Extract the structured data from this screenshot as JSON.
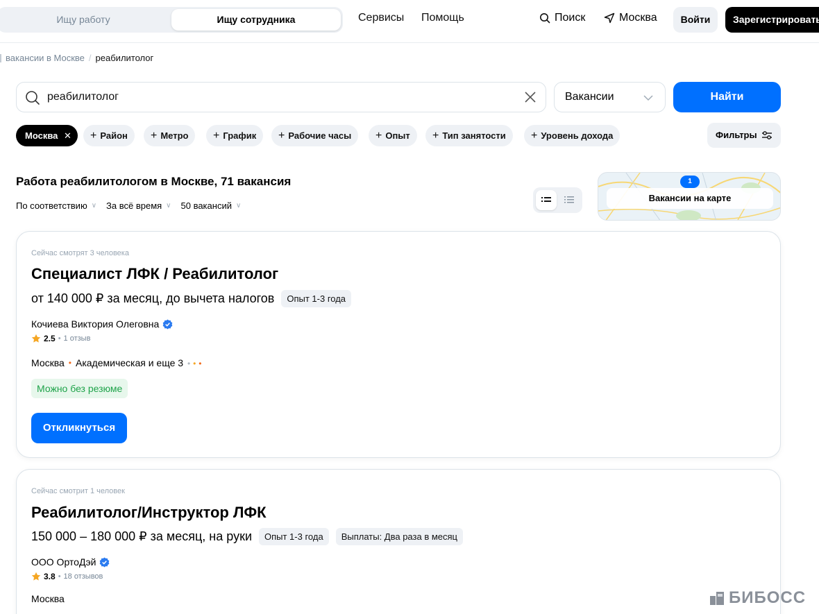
{
  "header": {
    "role_job_seeker": "Ищу работу",
    "role_employer": "Ищу сотрудника",
    "nav_services": "Сервисы",
    "nav_help": "Помощь",
    "search_label": "Поиск",
    "city_label": "Москва",
    "login_label": "Войти",
    "register_label": "Зарегистрироваться"
  },
  "breadcrumb": {
    "parent": "вакансии в Москве",
    "separator": "/",
    "current": "реабилитолог"
  },
  "search": {
    "query": "реабилитолог",
    "type_selected": "Вакансии",
    "find_label": "Найти"
  },
  "filters": {
    "active_chip": "Москва",
    "chips": [
      "Район",
      "Метро",
      "График",
      "Рабочие часы",
      "Опыт",
      "Тип занятости",
      "Уровень дохода"
    ],
    "filters_label": "Фильтры"
  },
  "results": {
    "title": "Работа реабилитологом в Москве, 71 вакансия",
    "sort": [
      "По соответствию",
      "За всё время",
      "50 вакансий"
    ],
    "map_label": "Вакансии на карте",
    "map_pin_count": "1"
  },
  "vacancies": [
    {
      "watching": "Сейчас смотрят 3 человека",
      "title": "Специалист ЛФК / Реабилитолог",
      "salary": "от 140 000 ₽ за месяц, до вычета налогов",
      "tags": [
        "Опыт 1-3 года"
      ],
      "company": "Кочиева Виктория Олеговна",
      "rating": "2.5",
      "reviews": "1 отзыв",
      "location": "Москва",
      "metro": "Академическая и еще 3",
      "badge": "Можно без резюме",
      "respond_label": "Откликнуться"
    },
    {
      "watching": "Сейчас смотрит 1 человек",
      "title": "Реабилитолог/Инструктор ЛФК",
      "salary": "150 000 – 180 000 ₽ за месяц, на руки",
      "tags": [
        "Опыт 1-3 года",
        "Выплаты: Два раза в месяц"
      ],
      "company": "ООО ОртоДэй",
      "rating": "3.8",
      "reviews": "18 отзывов",
      "location": "Москва"
    }
  ],
  "watermark": "БИБОСС",
  "colors": {
    "accent": "#0070ff",
    "chip_bg": "#eef1f5",
    "success_bg": "#e7f7ec",
    "success_text": "#1fa34a",
    "metro_dot": "#f26b1d",
    "star": "#f5a623"
  }
}
